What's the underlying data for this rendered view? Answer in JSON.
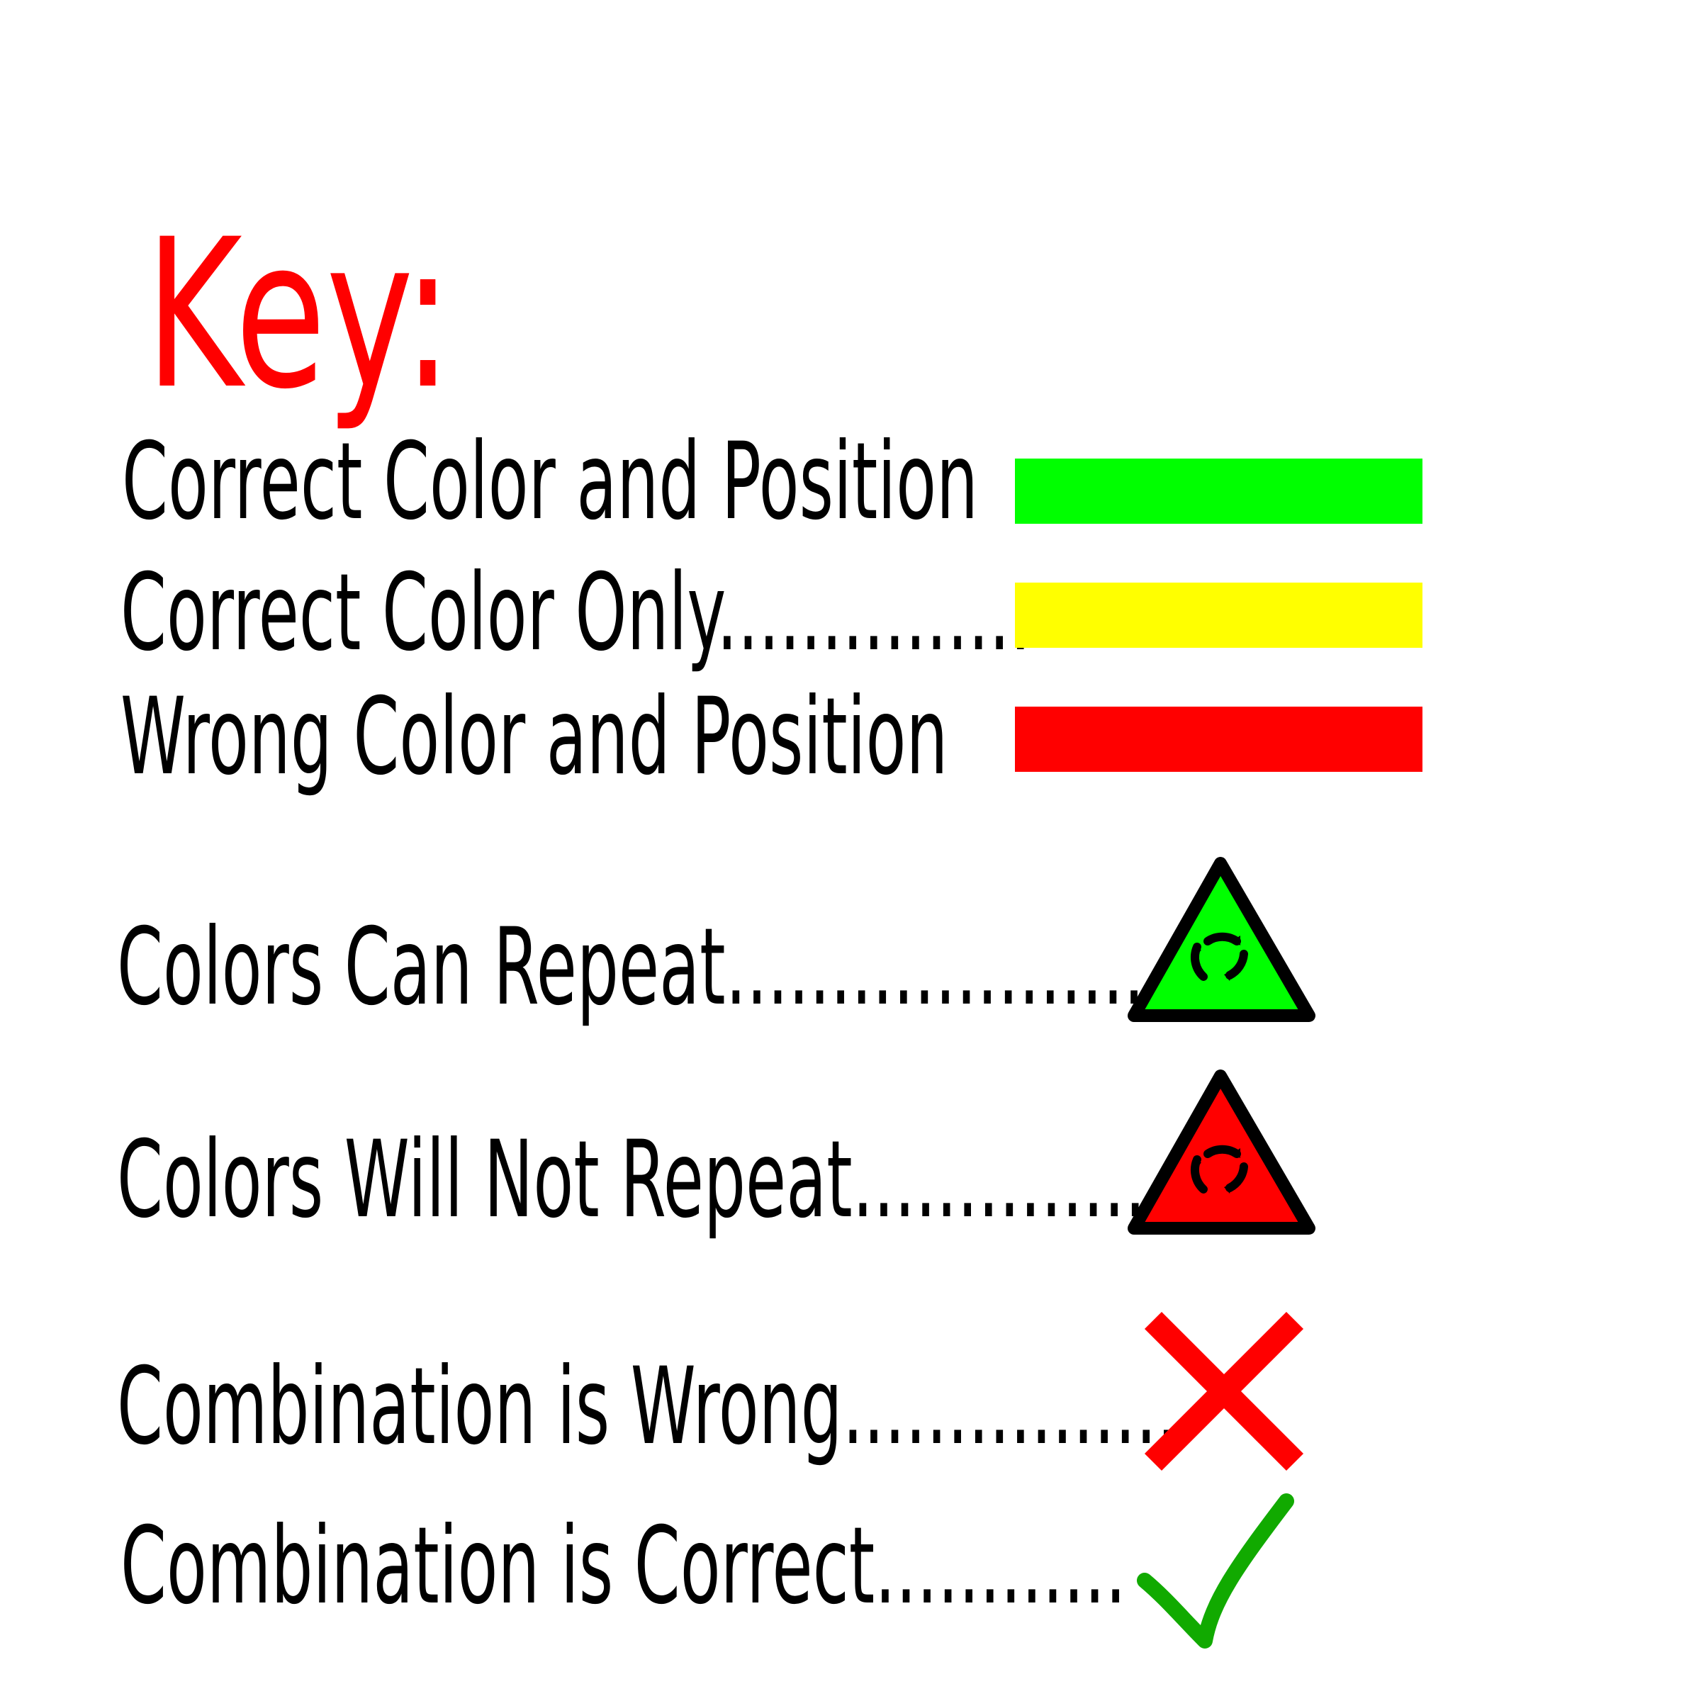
{
  "title": "Key:",
  "legend": [
    {
      "label": "Correct Color and Position",
      "color": "#00ff00",
      "icon": "green-swatch"
    },
    {
      "label": "Correct Color Only...............",
      "color": "#ffff00",
      "icon": "yellow-swatch"
    },
    {
      "label": "Wrong Color and Position",
      "color": "#ff0000",
      "icon": "red-swatch"
    },
    {
      "label": "Colors Can Repeat.....................",
      "color": "#00ff00",
      "icon": "repeat-triangle-green-icon"
    },
    {
      "label": "Colors Will Not Repeat..............",
      "color": "#ff0000",
      "icon": "repeat-triangle-red-icon"
    },
    {
      "label": "Combination is Wrong................",
      "color": "#ff0000",
      "icon": "red-x-icon"
    },
    {
      "label": "Combination is Correct............",
      "color": "#11aa00",
      "icon": "green-check-icon"
    }
  ]
}
